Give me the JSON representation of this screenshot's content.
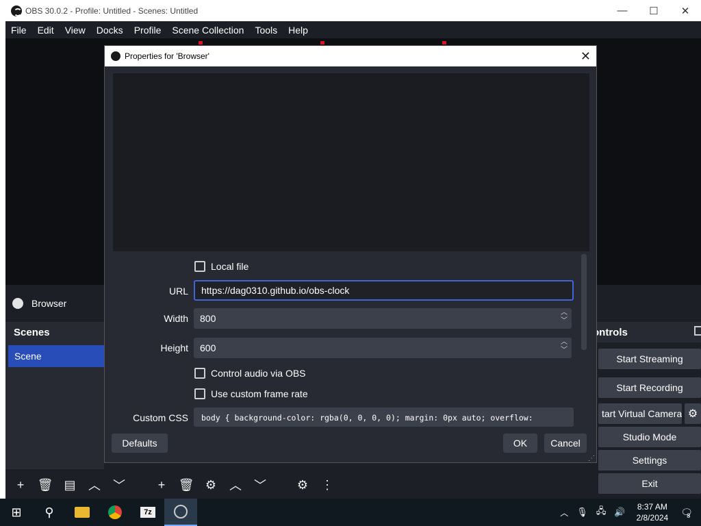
{
  "window": {
    "title": "OBS 30.0.2 - Profile: Untitled - Scenes: Untitled",
    "minimize": "—",
    "maximize": "☐",
    "close": "✕"
  },
  "menu": [
    "File",
    "Edit",
    "View",
    "Docks",
    "Profile",
    "Scene Collection",
    "Tools",
    "Help"
  ],
  "source_bar": {
    "label": "Browser"
  },
  "scenes": {
    "header": "Scenes",
    "items": [
      "Scene"
    ]
  },
  "controls": {
    "header": "ontrols",
    "buttons": [
      "Start Streaming",
      "Start Recording",
      "tart Virtual Camera",
      "Studio Mode",
      "Settings",
      "Exit"
    ]
  },
  "dialog": {
    "title": "Properties for 'Browser'",
    "local_file_label": "Local file",
    "url_label": "URL",
    "url_value": "https://dag0310.github.io/obs-clock",
    "width_label": "Width",
    "width_value": "800",
    "height_label": "Height",
    "height_value": "600",
    "control_audio_label": "Control audio via OBS",
    "custom_frame_rate_label": "Use custom frame rate",
    "custom_css_label": "Custom CSS",
    "custom_css_value": "body { background-color: rgba(0, 0, 0, 0); margin: 0px auto; overflow:",
    "defaults_button": "Defaults",
    "ok_button": "OK",
    "cancel_button": "Cancel"
  },
  "taskbar": {
    "time": "8:37 AM",
    "date": "2/8/2024",
    "notifications": "8"
  }
}
